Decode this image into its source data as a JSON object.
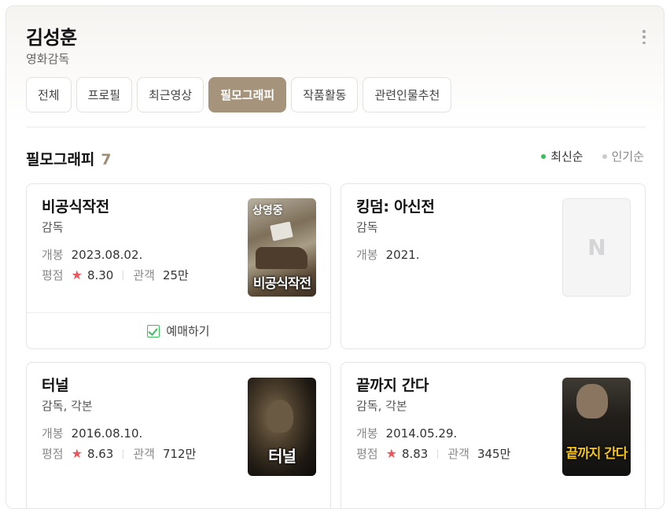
{
  "person": {
    "name": "김성훈",
    "job": "영화감독"
  },
  "tabs": [
    {
      "label": "전체"
    },
    {
      "label": "프로필"
    },
    {
      "label": "최근영상"
    },
    {
      "label": "필모그래피",
      "active": true
    },
    {
      "label": "작품활동"
    },
    {
      "label": "관련인물추천"
    }
  ],
  "section": {
    "title": "필모그래피",
    "count": "7"
  },
  "sort": {
    "latest": "최신순",
    "popular": "인기순",
    "selected": "최신순"
  },
  "labels": {
    "release": "개봉",
    "rating": "평점",
    "audience": "관객",
    "star": "★"
  },
  "cards": [
    {
      "title": "비공식작전",
      "role": "감독",
      "release": "2023.08.02.",
      "rating": "8.30",
      "audience": "25만",
      "badge": "상영중",
      "poster_text": "비공식작전",
      "booking": "예매하기"
    },
    {
      "title": "킹덤: 아신전",
      "role": "감독",
      "release": "2021.",
      "noimg": "N"
    },
    {
      "title": "터널",
      "role": "감독, 각본",
      "release": "2016.08.10.",
      "rating": "8.63",
      "audience": "712만",
      "poster_text": "터널"
    },
    {
      "title": "끝까지 간다",
      "role": "감독, 각본",
      "release": "2014.05.29.",
      "rating": "8.83",
      "audience": "345만",
      "poster_text": "끝까지 간다"
    }
  ],
  "colors": {
    "accent": "#a5937c",
    "star": "#e9565b",
    "green": "#3dbd5d"
  }
}
